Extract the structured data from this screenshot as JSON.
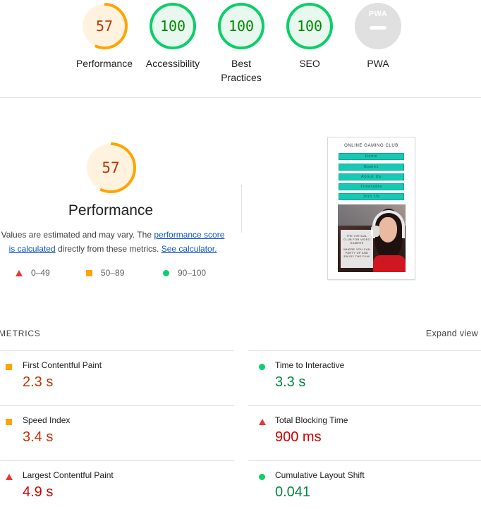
{
  "gauges": [
    {
      "score": "57",
      "label": "Performance",
      "color": "#ffa400",
      "value": 0.57,
      "tone": "orange"
    },
    {
      "score": "100",
      "label": "Accessibility",
      "color": "#0cce6b",
      "value": 1.0,
      "tone": "green"
    },
    {
      "score": "100",
      "label": "Best Practices",
      "color": "#0cce6b",
      "value": 1.0,
      "tone": "green"
    },
    {
      "score": "100",
      "label": "SEO",
      "color": "#0cce6b",
      "value": 1.0,
      "tone": "green"
    },
    {
      "score": "PWA",
      "label": "PWA",
      "color": "#e0e0e0",
      "value": 0,
      "tone": "gray"
    }
  ],
  "performance": {
    "score": "57",
    "value": 0.57,
    "title": "Performance",
    "desc_prefix": "Values are estimated and may vary. The ",
    "desc_link1": "performance score is calculated",
    "desc_middle": " directly from these metrics. ",
    "desc_link2": "See calculator."
  },
  "legend": {
    "fail": "0–49",
    "average": "50–89",
    "pass": "90–100"
  },
  "thumbnail": {
    "site_title": "ONLINE GAMING CLUB",
    "nav": [
      "Home",
      "Games",
      "About Us",
      "Timetable",
      "Join Us"
    ],
    "card_line1": "THE VIRTUAL CLUB FOR VIDEO GAMERS",
    "card_line2": "WHERE YOU CAN PARTY UP AND ENJOY THE FUN!"
  },
  "metrics_section": {
    "heading": "METRICS",
    "expand_label": "Expand view"
  },
  "metrics": [
    {
      "name": "First Contentful Paint",
      "value": "2.3 s",
      "rating": "average"
    },
    {
      "name": "Time to Interactive",
      "value": "3.3 s",
      "rating": "pass"
    },
    {
      "name": "Speed Index",
      "value": "3.4 s",
      "rating": "average"
    },
    {
      "name": "Total Blocking Time",
      "value": "900 ms",
      "rating": "fail"
    },
    {
      "name": "Largest Contentful Paint",
      "value": "4.9 s",
      "rating": "fail"
    },
    {
      "name": "Cumulative Layout Shift",
      "value": "0.041",
      "rating": "pass"
    }
  ],
  "colors": {
    "fail": "#e53935",
    "average": "#ffa400",
    "pass": "#0cce6b",
    "link": "#1155cc"
  }
}
